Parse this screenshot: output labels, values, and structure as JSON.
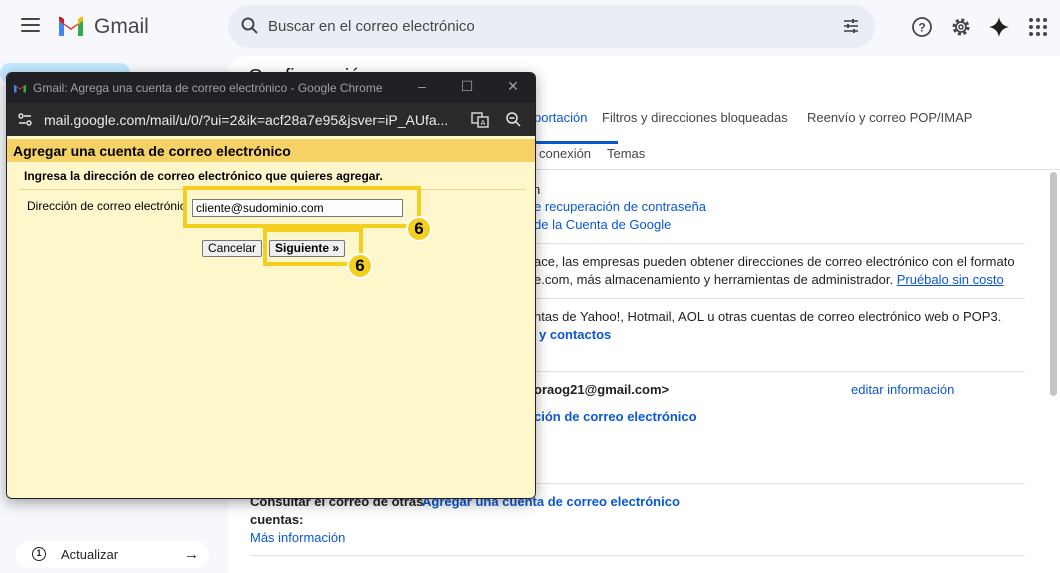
{
  "header": {
    "app_name": "Gmail",
    "search_placeholder": "Buscar en el correo electrónico"
  },
  "sidebar": {
    "update_count": "1",
    "update_label": "Actualizar"
  },
  "main": {
    "title": "Configuración",
    "tabs": [
      {
        "label": "portación",
        "active": true
      },
      {
        "label": "Filtros y direcciones bloqueadas"
      },
      {
        "label": "Reenvío y correo POP/IMAP"
      },
      {
        "label": "conexión"
      },
      {
        "label": "Temas"
      }
    ],
    "lines": {
      "l1": "n",
      "l2": "e recuperación de contraseña",
      "l3": "de la Cuenta de Google",
      "l4": "ace, las empresas pueden obtener direcciones de correo electrónico con el formato",
      "l5a": "e.com, más almacenamiento y herramientas de administrador. ",
      "l5b": "Pruébalo sin costo",
      "l6": "ntas de Yahoo!, Hotmail, AOL u otras cuentas de correo electrónico web o POP3.",
      "l7": "y contactos",
      "l8": "oraog21@gmail.com>",
      "l8_edit": "editar información",
      "l9": "ción de correo electrónico",
      "l10_label": "Consultar el correo de otras",
      "l10_link": "Agregar una cuenta de correo electrónico",
      "l11": "cuentas:",
      "l12": "Más información"
    }
  },
  "popup": {
    "window_title": "Gmail: Agrega una cuenta de correo electrónico - Google Chrome",
    "url": "mail.google.com/mail/u/0/?ui=2&ik=acf28a7e95&jsver=iP_AUfa...",
    "heading": "Agregar una cuenta de correo electrónico",
    "instruction": "Ingresa la dirección de correo electrónico que quieres agregar.",
    "email_label": "Dirección de correo electrónico:",
    "email_value": "cliente@sudominio.com",
    "cancel_label": "Cancelar",
    "next_label": "Siguiente »"
  },
  "annotations": {
    "step_1": "6",
    "step_2": "6",
    "color": "#f5cf1f"
  }
}
